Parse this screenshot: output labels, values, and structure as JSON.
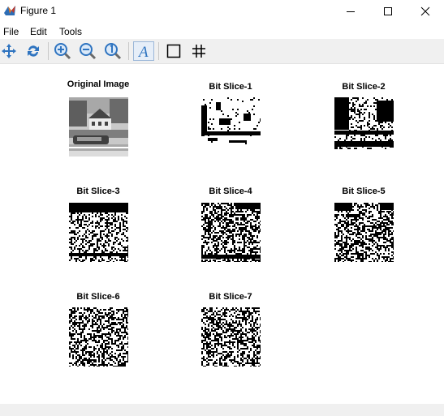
{
  "window": {
    "title": "Figure 1"
  },
  "menu": {
    "items": [
      "File",
      "Edit",
      "Tools"
    ]
  },
  "toolbar": {
    "buttons": [
      "pan-icon",
      "rotate-icon",
      "zoom-in-icon",
      "zoom-out-icon",
      "data-cursor-icon",
      "insert-text-icon",
      "insert-rectangle-icon",
      "grid-icon"
    ]
  },
  "figure": {
    "panels": [
      {
        "title": "Original Image"
      },
      {
        "title": "Bit Slice-1"
      },
      {
        "title": "Bit Slice-2"
      },
      {
        "title": "Bit Slice-3"
      },
      {
        "title": "Bit Slice-4"
      },
      {
        "title": "Bit Slice-5"
      },
      {
        "title": "Bit Slice-6"
      },
      {
        "title": "Bit Slice-7"
      }
    ]
  }
}
